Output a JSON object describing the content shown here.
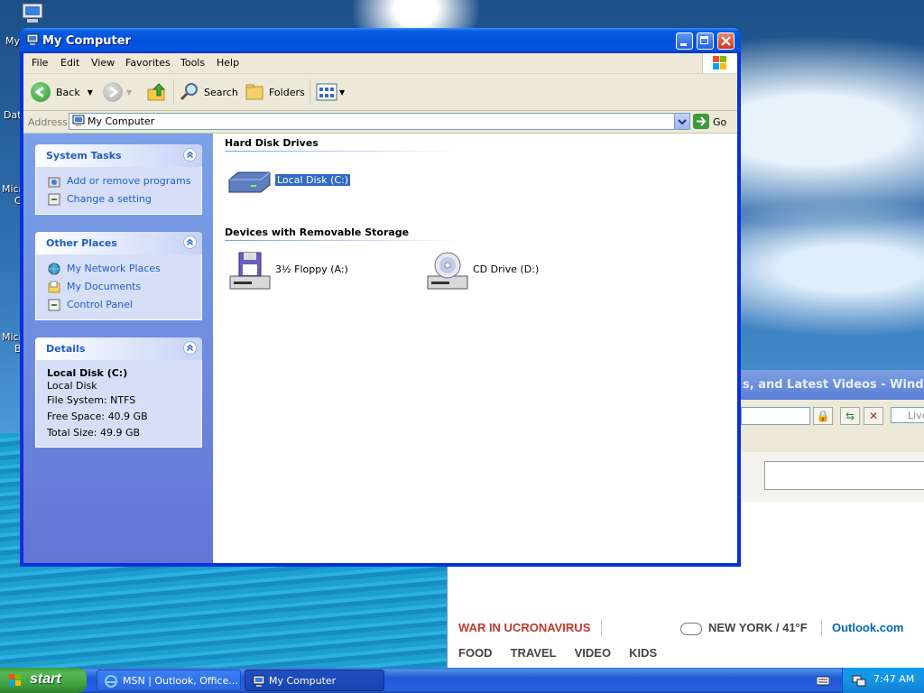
{
  "desktop": {
    "labels": [
      "My",
      "Dat",
      "Micro",
      "Micro"
    ],
    "label_second": [
      "",
      "",
      "C",
      "B"
    ]
  },
  "background_window": {
    "title": "s, and Latest Videos - Windows I",
    "search_placeholder": "Live",
    "news_text": "WAR IN UCRONAVIRUS",
    "weather_text": "NEW YORK / 41°F",
    "outlook_text": "Outlook.com",
    "categories": [
      "FOOD",
      "TRAVEL",
      "VIDEO",
      "KIDS"
    ]
  },
  "window": {
    "title": "My Computer",
    "menu": [
      "File",
      "Edit",
      "View",
      "Favorites",
      "Tools",
      "Help"
    ],
    "toolbar": {
      "back": "Back",
      "search": "Search",
      "folders": "Folders"
    },
    "address": {
      "label": "Address",
      "value": "My Computer",
      "go": "Go"
    },
    "panels": {
      "system_tasks": {
        "title": "System Tasks",
        "items": [
          "Add or remove programs",
          "Change a setting"
        ]
      },
      "other_places": {
        "title": "Other Places",
        "items": [
          "My Network Places",
          "My Documents",
          "Control Panel"
        ]
      },
      "details": {
        "title": "Details",
        "name": "Local Disk (C:)",
        "type": "Local Disk",
        "file_system": "File System: NTFS",
        "free_space": "Free Space: 40.9 GB",
        "total_size": "Total Size: 49.9 GB"
      }
    },
    "groups": {
      "hard_disk": {
        "title": "Hard Disk Drives",
        "items": [
          "Local Disk (C:)"
        ]
      },
      "removable": {
        "title": "Devices with Removable Storage",
        "items": [
          "3½ Floppy (A:)",
          "CD Drive (D:)"
        ]
      }
    }
  },
  "taskbar": {
    "start": "start",
    "tasks": [
      "MSN | Outlook, Office...",
      "My Computer"
    ],
    "clock": "7:47 AM"
  },
  "colors": {
    "titlebar": "#0450d8",
    "taskpane_link": "#215dc6",
    "selection": "#316ac5",
    "start_green": "#3d9f3d"
  }
}
